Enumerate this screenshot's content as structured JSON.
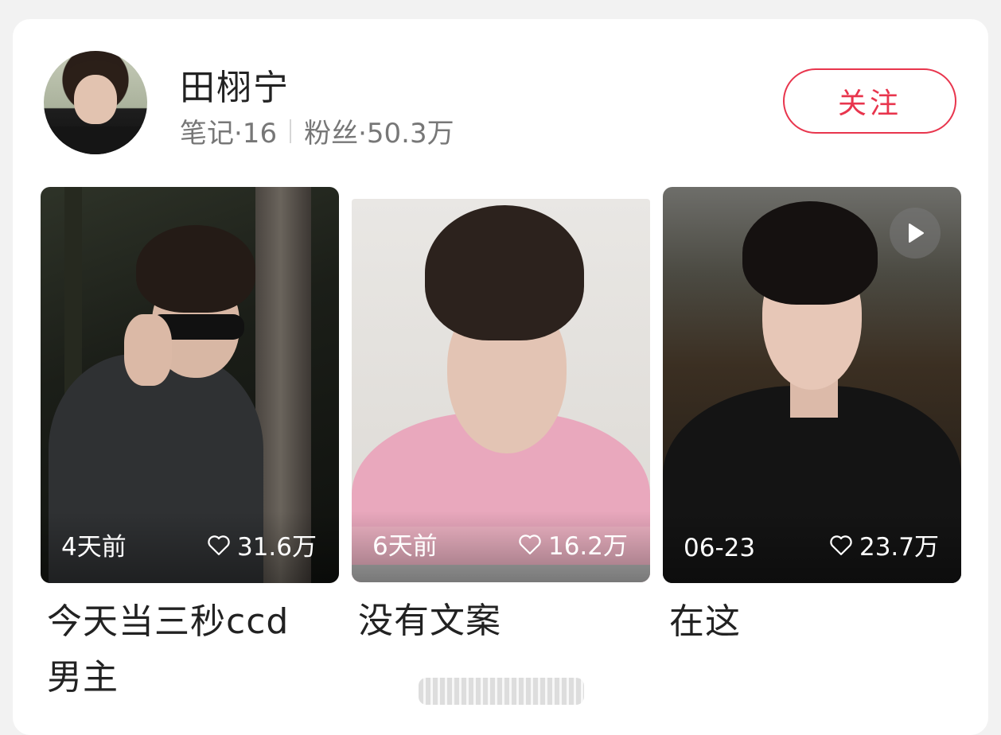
{
  "profile": {
    "name": "田栩宁",
    "notes": "笔记·16",
    "fans": "粉丝·50.3万",
    "follow_label": "关注"
  },
  "posts": [
    {
      "time": "4天前",
      "likes": "31.6万",
      "caption": "今天当三秒ccd男主",
      "has_video": false
    },
    {
      "time": "6天前",
      "likes": "16.2万",
      "caption": "没有文案",
      "has_video": false
    },
    {
      "time": "06-23",
      "likes": "23.7万",
      "caption": "在这",
      "has_video": true
    }
  ],
  "icons": {
    "like": "heart-outline-icon",
    "video": "play-icon"
  },
  "colors": {
    "accent": "#e8354d",
    "text_primary": "#222222",
    "text_secondary": "#777777"
  }
}
